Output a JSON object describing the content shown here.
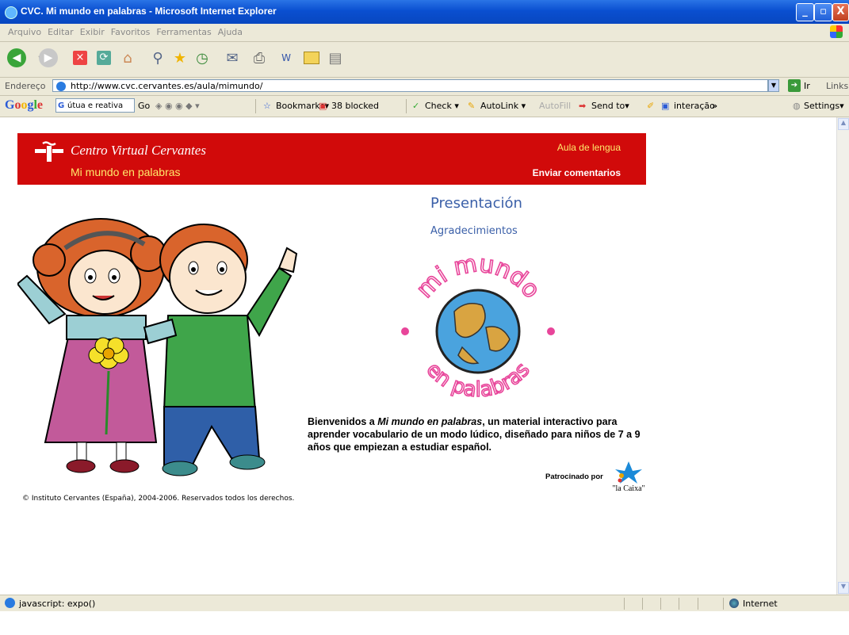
{
  "window": {
    "title": "CVC. Mi mundo en palabras - Microsoft Internet Explorer",
    "minimize": "_",
    "maximize": "▫",
    "close": "X"
  },
  "menu": [
    "Arquivo",
    "Editar",
    "Exibir",
    "Favoritos",
    "Ferramentas",
    "Ajuda"
  ],
  "address_bar": {
    "label": "Endereço",
    "url": "http://www.cvc.cervantes.es/aula/mimundo/",
    "go_label": "Ir",
    "links_label": "Links"
  },
  "google_toolbar": {
    "logo": "Google",
    "search_value": "útua e reativa",
    "go": "Go",
    "bookmarks": "Bookmarks▾",
    "blocked": "38 blocked",
    "check": "Check ▾",
    "autolink": "AutoLink ▾",
    "autofill": "AutoFill",
    "send_to": "Send to▾",
    "interacao": "interação",
    "more": "»",
    "settings": "Settings▾"
  },
  "page": {
    "org_name": "Centro Virtual Cervantes",
    "site_name": "Mi mundo en palabras",
    "aula_link": "Aula de lengua",
    "enviar_link": "Enviar comentarios",
    "presentacion": "Presentación",
    "agradecimientos": "Agradecimientos",
    "logo_top_text": "mi mundo",
    "logo_bottom_text": "en palabras",
    "welcome_prefix": "Bienvenidos a ",
    "welcome_italic": "Mi mundo en palabras",
    "welcome_suffix": ", un material interactivo para aprender vocabulario de un modo lúdico, diseñado para niños de 7 a 9 años que empiezan a estudiar español.",
    "sponsor_label": "Patrocinado por",
    "sponsor_name": "\"la Caixa\"",
    "copyright": "© Instituto Cervantes (España), 2004-2006. Reservados todos los derechos."
  },
  "status": {
    "text": "javascript: expo()",
    "zone": "Internet"
  },
  "colors": {
    "banner_red": "#d10a0a",
    "link_blue": "#3a5fa8",
    "logo_pink": "#e8459a",
    "title_bar_blue": "#0a4fd0"
  }
}
